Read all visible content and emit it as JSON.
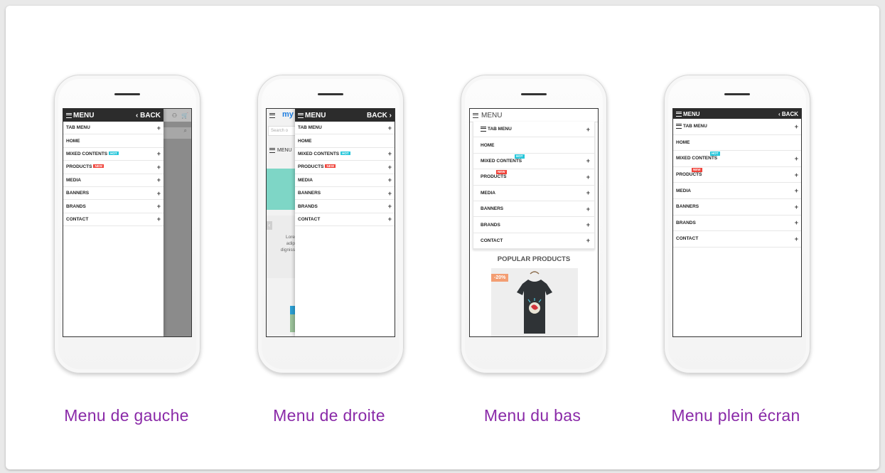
{
  "captions": [
    "Menu de gauche",
    "Menu de droite",
    "Menu du bas",
    "Menu plein écran"
  ],
  "menu": {
    "title": "MENU",
    "back": "BACK",
    "back_left": "‹ BACK",
    "back_right": "BACK ›",
    "items": [
      {
        "label": "TAB MENU",
        "plus": "+"
      },
      {
        "label": "HOME",
        "plus": ""
      },
      {
        "label": "MIXED CONTENTS",
        "plus": "+",
        "badge": "HOT"
      },
      {
        "label": "PRODUCTS",
        "plus": "+",
        "badge": "NEW"
      },
      {
        "label": "MEDIA",
        "plus": "+"
      },
      {
        "label": "BANNERS",
        "plus": "+"
      },
      {
        "label": "BRANDS",
        "plus": "+"
      },
      {
        "label": "CONTACT",
        "plus": "+"
      }
    ]
  },
  "phone2": {
    "logo": "my",
    "search_placeholder": "Search o",
    "menu_label": "MENU",
    "lorem": [
      "Lore",
      "adip",
      "digniss"
    ]
  },
  "phone3": {
    "top_menu": "MENU",
    "popular_title": "POPULAR PRODUCTS",
    "discount": "-20%"
  },
  "icons": {
    "user": "user-icon",
    "cart": "cart-icon",
    "search": "search-icon",
    "hamburger": "hamburger-icon"
  },
  "colors": {
    "caption": "#8a2aa8",
    "bar": "#2c2c2c",
    "hot": "#26c6da",
    "new": "#f0433a"
  }
}
